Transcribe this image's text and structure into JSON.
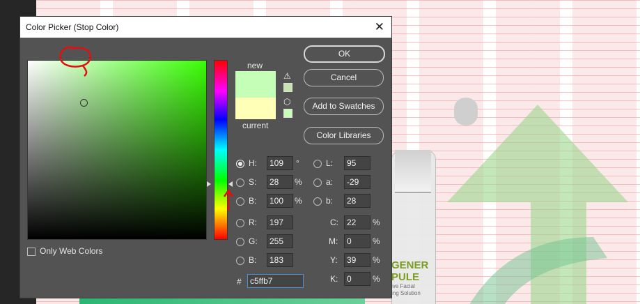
{
  "dialog": {
    "title": "Color Picker (Stop Color)",
    "close_label": "✕"
  },
  "buttons": {
    "ok": "OK",
    "cancel": "Cancel",
    "add_to_swatches": "Add to Swatches",
    "color_libraries": "Color Libraries"
  },
  "preview": {
    "new_label": "new",
    "current_label": "current",
    "new_color": "#c5ffb7",
    "current_color": "#ffffb7",
    "warning_icon": "⚠",
    "cube_icon": "⬡"
  },
  "fields": {
    "H": {
      "label": "H:",
      "value": "109",
      "unit": "°"
    },
    "S": {
      "label": "S:",
      "value": "28",
      "unit": "%"
    },
    "Bv": {
      "label": "B:",
      "value": "100",
      "unit": "%"
    },
    "R": {
      "label": "R:",
      "value": "197"
    },
    "G": {
      "label": "G:",
      "value": "255"
    },
    "Bc": {
      "label": "B:",
      "value": "183"
    },
    "L": {
      "label": "L:",
      "value": "95"
    },
    "a": {
      "label": "a:",
      "value": "-29"
    },
    "b": {
      "label": "b:",
      "value": "28"
    },
    "C": {
      "label": "C:",
      "value": "22",
      "unit": "%"
    },
    "M": {
      "label": "M:",
      "value": "0",
      "unit": "%"
    },
    "Y": {
      "label": "Y:",
      "value": "39",
      "unit": "%"
    },
    "K": {
      "label": "K:",
      "value": "0",
      "unit": "%"
    },
    "hex": {
      "label": "#",
      "value": "c5ffb7"
    }
  },
  "only_web_colors": "Only Web Colors",
  "background": {
    "product_line1": "GENER",
    "product_line2": "PULE",
    "product_line3": "ive Facial",
    "product_line4": "ing Solution"
  }
}
